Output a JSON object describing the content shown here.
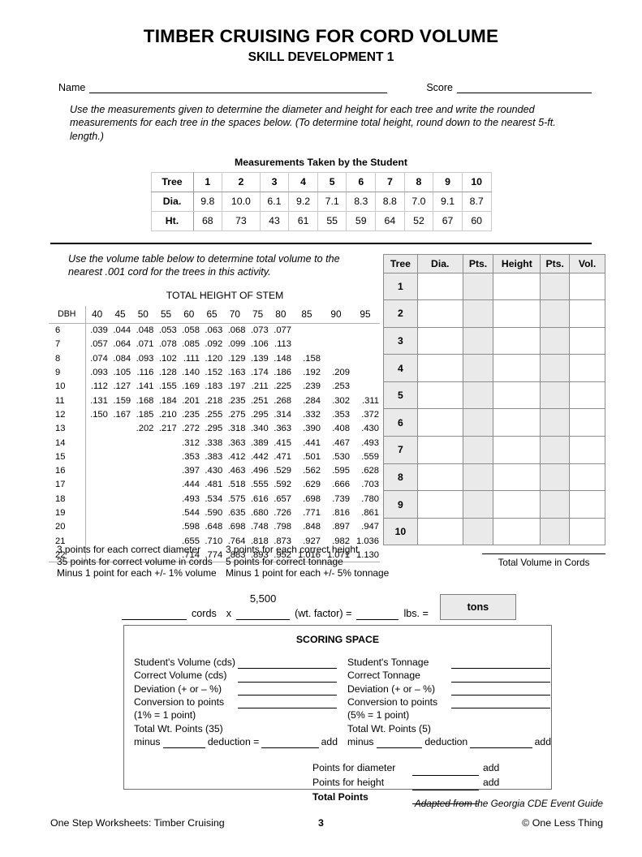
{
  "header": {
    "title": "TIMBER CRUISING FOR CORD VOLUME",
    "subtitle": "SKILL DEVELOPMENT 1",
    "name_label": "Name",
    "score_label": "Score"
  },
  "intro": "Use the measurements given to determine the diameter and height for each tree and write the rounded measurements for each tree in the spaces below. (To determine total height, round down to the nearest 5-ft. length.)",
  "measurements": {
    "caption": "Measurements Taken by the Student",
    "rows": [
      {
        "label": "Tree",
        "values": [
          "1",
          "2",
          "3",
          "4",
          "5",
          "6",
          "7",
          "8",
          "9",
          "10"
        ]
      },
      {
        "label": "Dia.",
        "values": [
          "9.8",
          "10.0",
          "6.1",
          "9.2",
          "7.1",
          "8.3",
          "8.8",
          "7.0",
          "9.1",
          "8.7"
        ]
      },
      {
        "label": "Ht.",
        "values": [
          "68",
          "73",
          "43",
          "61",
          "55",
          "59",
          "64",
          "52",
          "67",
          "60"
        ]
      }
    ]
  },
  "volume_instruction": "Use the volume table below to determine total volume to the nearest .001 cord for the trees in this activity.",
  "chart_data": {
    "type": "table",
    "title": "TOTAL HEIGHT OF STEM",
    "xlabel": "TOTAL HEIGHT OF STEM",
    "ylabel": "DBH",
    "corner_label": "DBH",
    "categories": [
      "40",
      "45",
      "50",
      "55",
      "60",
      "65",
      "70",
      "75",
      "80",
      "85",
      "90",
      "95"
    ],
    "rows": [
      {
        "dbh": "6",
        "values": [
          ".039",
          ".044",
          ".048",
          ".053",
          ".058",
          ".063",
          ".068",
          ".073",
          ".077",
          "",
          "",
          ""
        ]
      },
      {
        "dbh": "7",
        "values": [
          ".057",
          ".064",
          ".071",
          ".078",
          ".085",
          ".092",
          ".099",
          ".106",
          ".113",
          "",
          "",
          ""
        ]
      },
      {
        "dbh": "8",
        "values": [
          ".074",
          ".084",
          ".093",
          ".102",
          ".111",
          ".120",
          ".129",
          ".139",
          ".148",
          ".158",
          "",
          ""
        ]
      },
      {
        "dbh": "9",
        "values": [
          ".093",
          ".105",
          ".116",
          ".128",
          ".140",
          ".152",
          ".163",
          ".174",
          ".186",
          ".192",
          ".209",
          ""
        ]
      },
      {
        "dbh": "10",
        "values": [
          ".112",
          ".127",
          ".141",
          ".155",
          ".169",
          ".183",
          ".197",
          ".211",
          ".225",
          ".239",
          ".253",
          ""
        ]
      },
      {
        "dbh": "11",
        "values": [
          ".131",
          ".159",
          ".168",
          ".184",
          ".201",
          ".218",
          ".235",
          ".251",
          ".268",
          ".284",
          ".302",
          ".311"
        ]
      },
      {
        "dbh": "12",
        "values": [
          ".150",
          ".167",
          ".185",
          ".210",
          ".235",
          ".255",
          ".275",
          ".295",
          ".314",
          ".332",
          ".353",
          ".372"
        ]
      },
      {
        "dbh": "13",
        "values": [
          "",
          "",
          ".202",
          ".217",
          ".272",
          ".295",
          ".318",
          ".340",
          ".363",
          ".390",
          ".408",
          ".430"
        ]
      },
      {
        "dbh": "14",
        "values": [
          "",
          "",
          "",
          "",
          ".312",
          ".338",
          ".363",
          ".389",
          ".415",
          ".441",
          ".467",
          ".493"
        ]
      },
      {
        "dbh": "15",
        "values": [
          "",
          "",
          "",
          "",
          ".353",
          ".383",
          ".412",
          ".442",
          ".471",
          ".501",
          ".530",
          ".559"
        ]
      },
      {
        "dbh": "16",
        "values": [
          "",
          "",
          "",
          "",
          ".397",
          ".430",
          ".463",
          ".496",
          ".529",
          ".562",
          ".595",
          ".628"
        ]
      },
      {
        "dbh": "17",
        "values": [
          "",
          "",
          "",
          "",
          ".444",
          ".481",
          ".518",
          ".555",
          ".592",
          ".629",
          ".666",
          ".703"
        ]
      },
      {
        "dbh": "18",
        "values": [
          "",
          "",
          "",
          "",
          ".493",
          ".534",
          ".575",
          ".616",
          ".657",
          ".698",
          ".739",
          ".780"
        ]
      },
      {
        "dbh": "19",
        "values": [
          "",
          "",
          "",
          "",
          ".544",
          ".590",
          ".635",
          ".680",
          ".726",
          ".771",
          ".816",
          ".861"
        ]
      },
      {
        "dbh": "20",
        "values": [
          "",
          "",
          "",
          "",
          ".598",
          ".648",
          ".698",
          ".748",
          ".798",
          ".848",
          ".897",
          ".947"
        ]
      },
      {
        "dbh": "21",
        "values": [
          "",
          "",
          "",
          "",
          ".655",
          ".710",
          ".764",
          ".818",
          ".873",
          ".927",
          ".982",
          "1.036"
        ]
      },
      {
        "dbh": "22",
        "values": [
          "",
          "",
          "",
          "",
          ".714",
          ".774",
          ".883",
          ".893",
          ".952",
          "1.016",
          "1.071",
          "1.130"
        ]
      }
    ]
  },
  "answer_table": {
    "headers": [
      "Tree",
      "Dia.",
      "Pts.",
      "Height",
      "Pts.",
      "Vol."
    ],
    "rows": [
      "1",
      "2",
      "3",
      "4",
      "5",
      "6",
      "7",
      "8",
      "9",
      "10"
    ]
  },
  "points_notes": {
    "col1": [
      "3 points for each correct diameter",
      "35 points for correct volume in cords",
      "Minus 1 point for each +/- 1% volume"
    ],
    "col2": [
      "3 points for each correct height",
      "5 points for correct tonnage",
      "Minus 1 point for each +/- 5% tonnage"
    ]
  },
  "total_volume_label": "Total Volume in Cords",
  "cords_row": {
    "cords_label": "cords",
    "times": "x",
    "wt_factor_value": "5,500",
    "wt_factor_label": "(wt. factor) =",
    "lbs_label": "lbs. =",
    "tons_label": "tons"
  },
  "scoring": {
    "title": "SCORING SPACE",
    "left": {
      "lines": [
        "Student's Volume (cds)",
        "Correct Volume (cds)",
        "Deviation (+ or – %)",
        "Conversion to points"
      ],
      "note": "(1% = 1 point)",
      "total_wt": "Total Wt. Points (35)",
      "minus": "minus",
      "deduction": "deduction =",
      "add": "add"
    },
    "right": {
      "lines": [
        "Student's Tonnage",
        "Correct Tonnage",
        "Deviation (+ or – %)",
        "Conversion to points"
      ],
      "note": "(5% = 1 point)",
      "total_wt": "Total Wt. Points (5)",
      "minus": "minus",
      "deduction": "deduction",
      "add": "add"
    },
    "bottom": [
      {
        "label": "Points for diameter",
        "suffix": "add",
        "bold": false
      },
      {
        "label": "Points for height",
        "suffix": "add",
        "bold": false
      },
      {
        "label": "Total Points",
        "suffix": "",
        "bold": true
      }
    ]
  },
  "footer": {
    "adapted": "Adapted from the Georgia CDE Event Guide",
    "left": "One Step Worksheets: Timber Cruising",
    "page": "3",
    "right": "© One Less Thing"
  }
}
